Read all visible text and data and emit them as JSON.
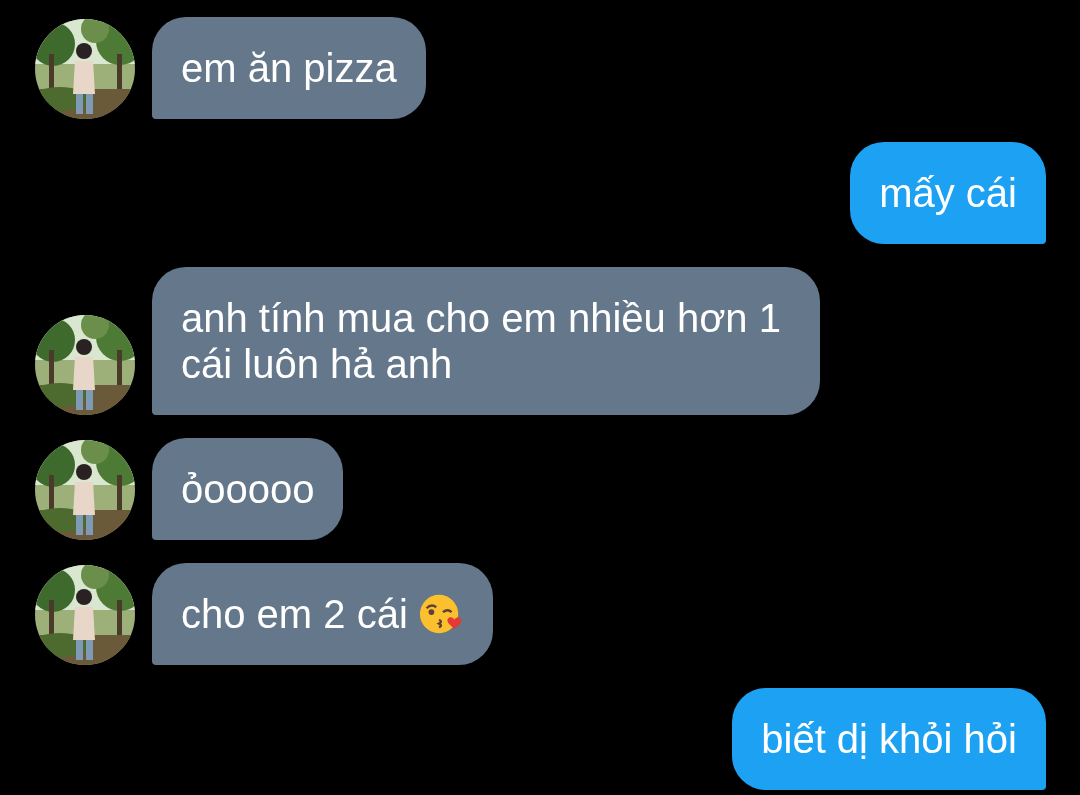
{
  "messages": [
    {
      "kind": "received",
      "avatar": true,
      "text": "em ăn pizza"
    },
    {
      "kind": "sent",
      "text": "mấy cái"
    },
    {
      "kind": "received",
      "avatar": true,
      "text": "anh tính mua cho em nhiều hơn 1 cái luôn hả anh"
    },
    {
      "kind": "received",
      "avatar": true,
      "text": "ỏooooo"
    },
    {
      "kind": "received",
      "avatar": true,
      "text": "cho em 2 cái",
      "emoji": true
    },
    {
      "kind": "sent",
      "text": "biết dị khỏi hỏi"
    }
  ]
}
